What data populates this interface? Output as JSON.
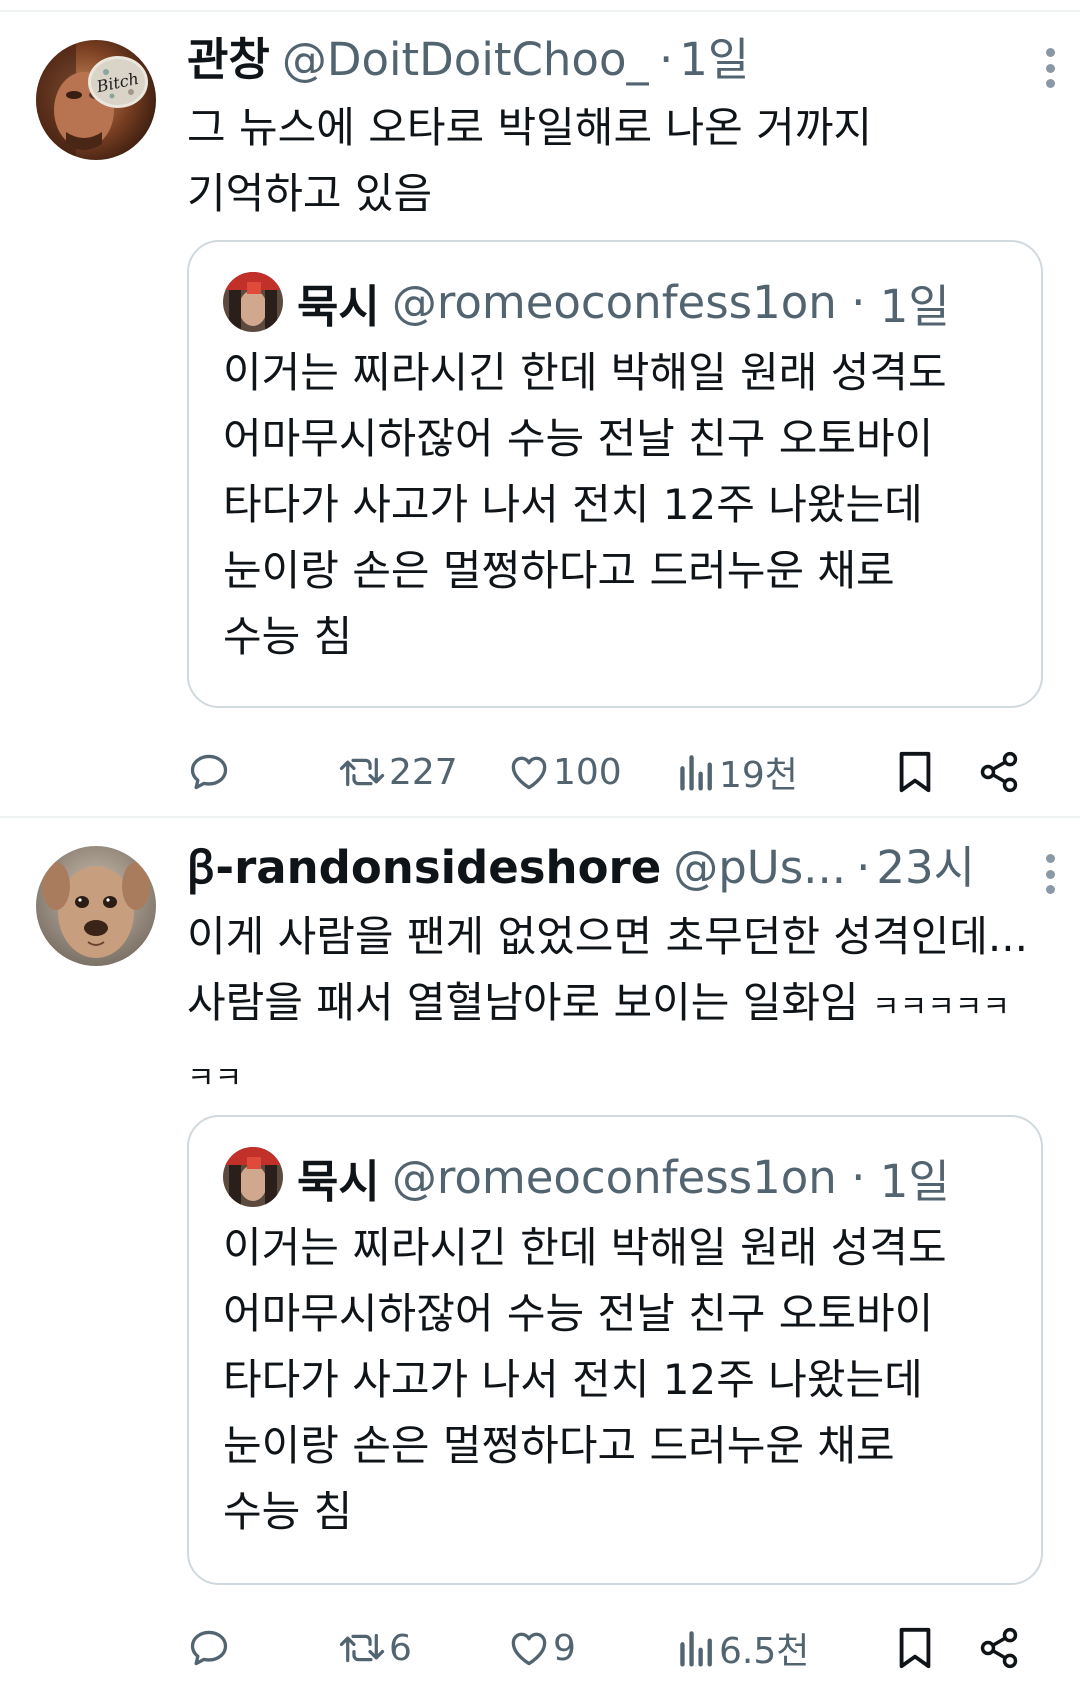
{
  "tweets": [
    {
      "name": "관창",
      "handle": "@DoitDoitChoo_",
      "time": "1일",
      "text": "그 뉴스에 오타로 박일해로 나온 거까지\n기억하고 있음",
      "text_suffix": "",
      "avatar_caption": "Bitch",
      "quote": {
        "name": "묵시",
        "handle": "@romeoconfess1on",
        "time": "1일",
        "text": "이거는 찌라시긴 한데 박해일 원래 성격도\n어마무시하잖어 수능 전날 친구 오토바이\n타다가 사고가 나서 전치 12주 나왔는데\n눈이랑 손은 멀쩡하다고 드러누운 채로\n수능 침"
      },
      "actions": {
        "replies": "",
        "retweets": "227",
        "likes": "100",
        "views": "19천"
      }
    },
    {
      "name": "ꞵ-randonsideshore",
      "handle": "@pUs...",
      "time": "23시",
      "text": "이게 사람을 팬게 없었으면 초무던한 성격인데...\n사람을 패서 열혈남아로 보이는 일화임 ",
      "text_suffix": "ㅋㅋㅋㅋㅋ\nㅋㅋ",
      "avatar_caption": "",
      "quote": {
        "name": "묵시",
        "handle": "@romeoconfess1on",
        "time": "1일",
        "text": "이거는 찌라시긴 한데 박해일 원래 성격도\n어마무시하잖어 수능 전날 친구 오토바이\n타다가 사고가 나서 전치 12주 나왔는데\n눈이랑 손은 멀쩡하다고 드러누운 채로\n수능 침"
      },
      "actions": {
        "replies": "",
        "retweets": "6",
        "likes": "9",
        "views": "6.5천"
      }
    }
  ],
  "icons": {
    "reply": "reply-icon",
    "retweet": "retweet-icon",
    "like": "heart-icon",
    "views": "views-chart-icon",
    "bookmark": "bookmark-icon",
    "share": "share-icon",
    "more": "more-options-icon"
  },
  "colors": {
    "text": "#0f1419",
    "secondary": "#536471",
    "border": "#cfd9de",
    "divider": "#eff3f4"
  }
}
